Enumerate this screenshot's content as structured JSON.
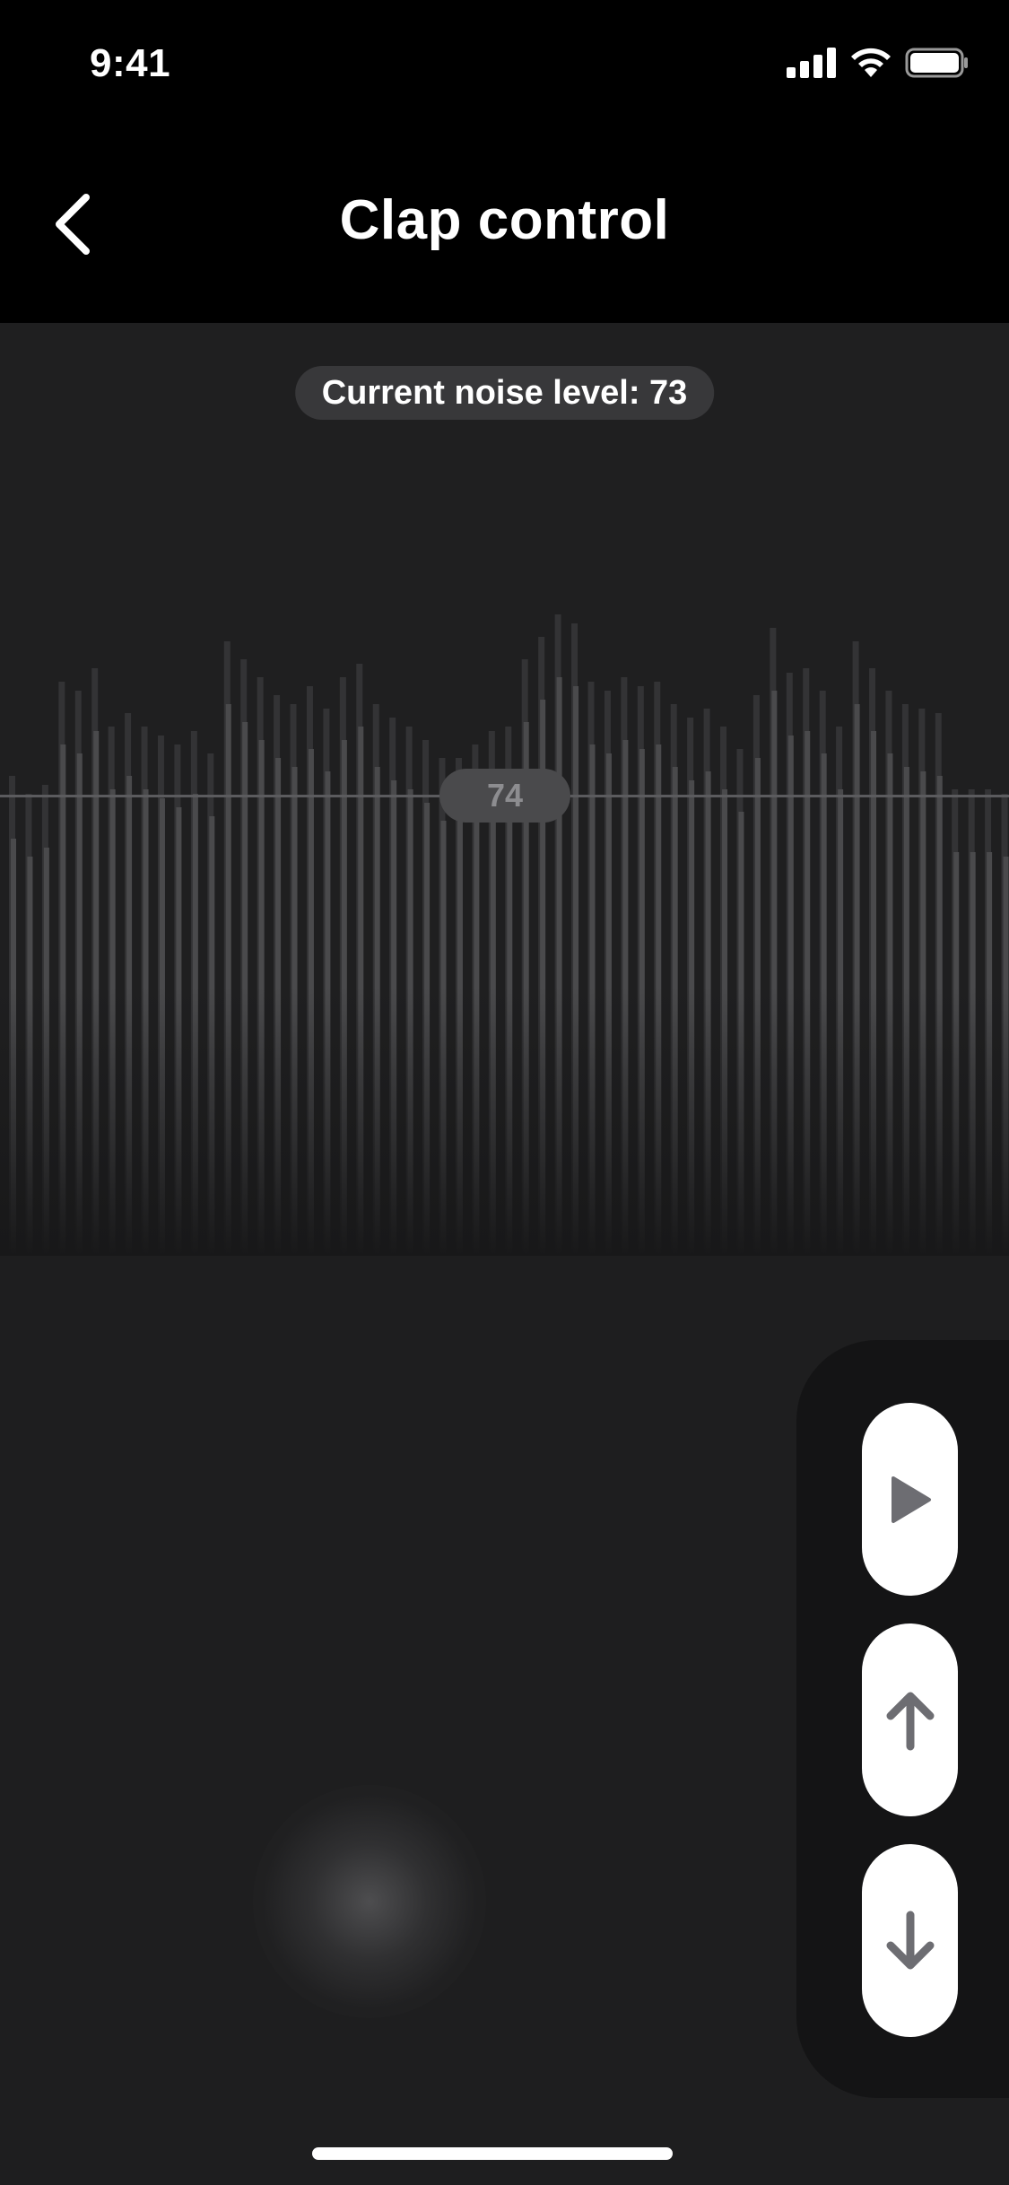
{
  "status_bar": {
    "time": "9:41",
    "icons": [
      "cellular-signal-icon",
      "wifi-icon",
      "battery-icon"
    ]
  },
  "nav": {
    "title": "Clap control",
    "back_icon": "chevron-left-icon"
  },
  "graph": {
    "noise_label": "Current noise level: 73",
    "threshold_value": "74",
    "bar_colors": {
      "front": "#4a4a4c",
      "back": "#333335"
    }
  },
  "controls": {
    "buttons": [
      {
        "name": "play-button",
        "icon": "play-icon"
      },
      {
        "name": "increase-button",
        "icon": "arrow-up-icon"
      },
      {
        "name": "decrease-button",
        "icon": "arrow-down-icon"
      }
    ],
    "icon_color": "#6d6d72"
  },
  "colors": {
    "background": "#1e1e1f",
    "header": "#000000",
    "panel": "#141415"
  }
}
